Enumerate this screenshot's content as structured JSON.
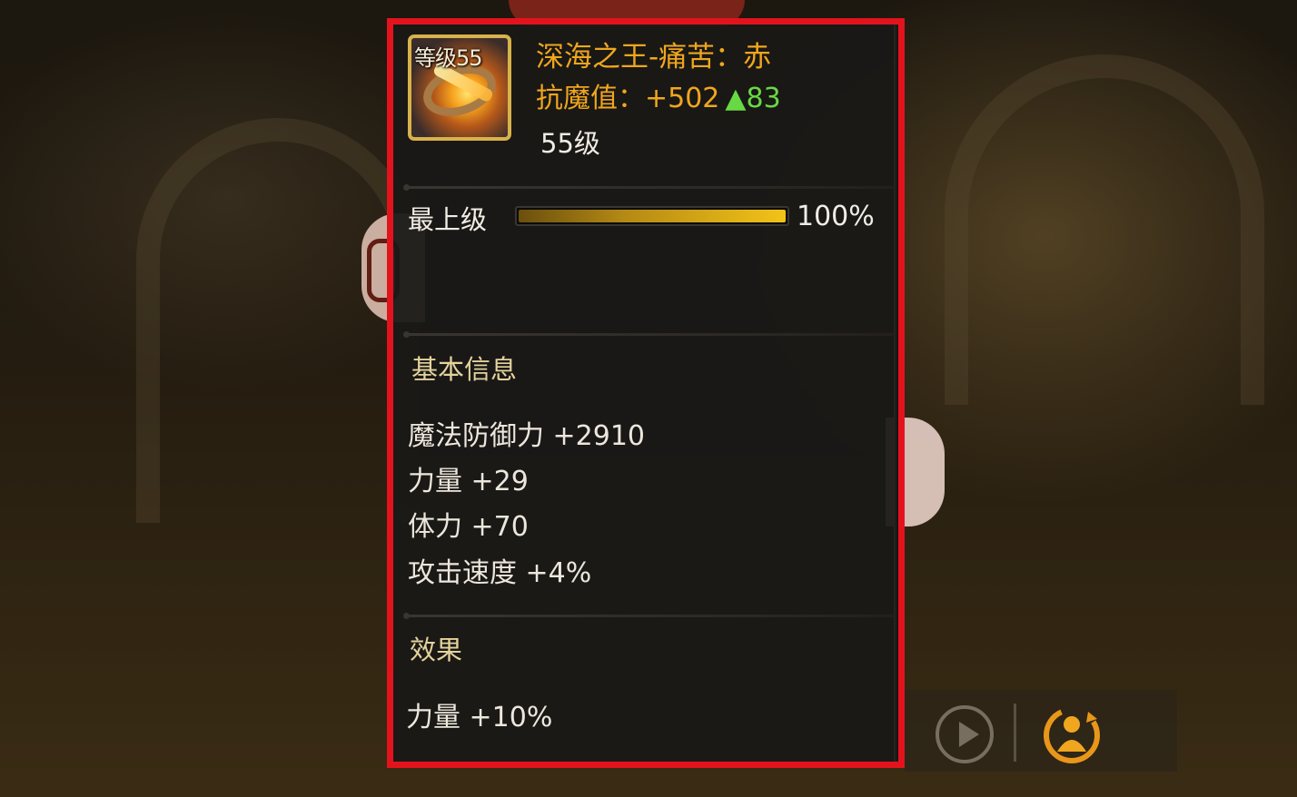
{
  "item": {
    "icon_level_label": "等级55",
    "name": "深海之王-痛苦：赤",
    "resist_label": "抗魔值：",
    "resist_value": "+502",
    "resist_up": "▲83",
    "level": "55级"
  },
  "grade": {
    "label": "最上级",
    "percent": 100,
    "percent_text": "100%"
  },
  "basic_info": {
    "title": "基本信息",
    "stats": [
      "魔法防御力 +2910",
      "力量 +29",
      "体力 +70",
      "攻击速度 +4%"
    ]
  },
  "effects": {
    "title": "效果",
    "lines": [
      "力量 +10%"
    ]
  },
  "colors": {
    "highlight_border": "#e3131e",
    "item_name": "#f0a61e",
    "stat_up": "#68d944",
    "section_title": "#e3d39c"
  },
  "hud": {
    "icons": [
      "play-icon",
      "character-swap-icon"
    ]
  }
}
